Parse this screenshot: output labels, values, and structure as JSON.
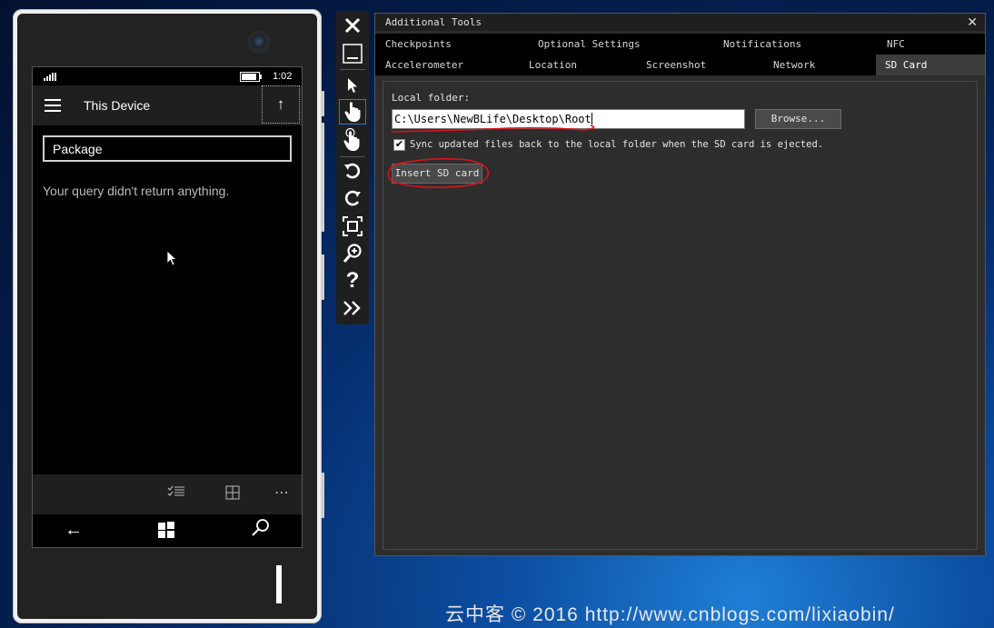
{
  "phone": {
    "status_time": "1:02",
    "header_title": "This Device",
    "search_value": "Package",
    "empty_message": "Your query didn't return anything."
  },
  "tools": {
    "window_title": "Additional Tools",
    "tabs_row1": [
      "Checkpoints",
      "Optional Settings",
      "Notifications",
      "NFC"
    ],
    "tabs_row2": [
      "Accelerometer",
      "Location",
      "Screenshot",
      "Network",
      "SD Card"
    ],
    "active_tab": "SD Card",
    "local_folder_label": "Local folder:",
    "local_folder_value": "C:\\Users\\NewBLife\\Desktop\\Root",
    "browse_label": "Browse...",
    "sync_label": "Sync updated files back to the local folder when the SD card is ejected.",
    "sync_checked": true,
    "insert_label": "Insert SD card"
  },
  "colors": {
    "annotation": "#d8141e",
    "active_tool": "#3a78c8"
  },
  "watermark": "云中客 © 2016  http://www.cnblogs.com/lixiaobin/"
}
